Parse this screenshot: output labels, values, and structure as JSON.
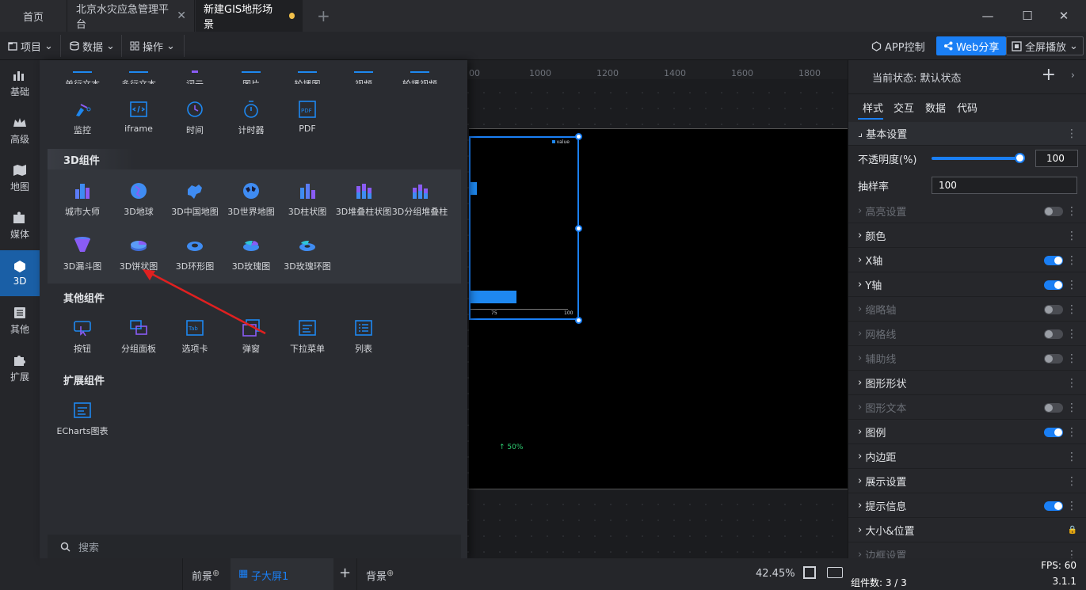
{
  "tabs": {
    "home": "首页",
    "beijing": "北京水灾应急管理平台",
    "gis": "新建GIS地形场景",
    "add": "+"
  },
  "window": {
    "minimize": "—",
    "maximize": "☐",
    "close": "✕"
  },
  "toolbar": {
    "project": "项目",
    "data": "数据",
    "operate": "操作",
    "app_control": "APP控制",
    "web_share": "Web分享",
    "fullscreen": "全屏播放"
  },
  "leftnav": [
    "基础",
    "高级",
    "地图",
    "媒体",
    "3D",
    "其他",
    "扩展"
  ],
  "basic_row1": [
    "单行文本",
    "多行文本",
    "词云",
    "图片",
    "轮播图",
    "视频",
    "轮播视频"
  ],
  "basic_row2": [
    "监控",
    "iframe",
    "时间",
    "计时器",
    "PDF"
  ],
  "section_3d": "3D组件",
  "comp3d_row1": [
    "城市大师",
    "3D地球",
    "3D中国地图",
    "3D世界地图",
    "3D柱状图",
    "3D堆叠柱状图",
    "3D分组堆叠柱"
  ],
  "comp3d_row2": [
    "3D漏斗图",
    "3D饼状图",
    "3D环形图",
    "3D玫瑰图",
    "3D玫瑰环图"
  ],
  "section_other": "其他组件",
  "other": [
    "按钮",
    "分组面板",
    "选项卡",
    "弹窗",
    "下拉菜单",
    "列表"
  ],
  "section_ext": "扩展组件",
  "ext": [
    "ECharts图表"
  ],
  "search_placeholder": "搜索",
  "ruler_labels": [
    "00",
    "1000",
    "1200",
    "1400",
    "1600",
    "1800"
  ],
  "canvas": {
    "legend": "value",
    "tick_a": "75",
    "tick_b": "100",
    "trend": "↑ 50%"
  },
  "right": {
    "state_label": "当前状态: 默认状态",
    "tabs": [
      "样式",
      "交互",
      "数据",
      "代码"
    ],
    "basic_settings": "基本设置",
    "opacity_label": "不透明度(%)",
    "opacity_value": "100",
    "opacity_level": 1.0,
    "sampling_label": "抽样率",
    "sampling_value": "100",
    "sections": [
      {
        "label": "高亮设置",
        "enabled": false,
        "toggle": "off"
      },
      {
        "label": "颜色",
        "enabled": true,
        "toggle": "none"
      },
      {
        "label": "X轴",
        "enabled": true,
        "toggle": "on"
      },
      {
        "label": "Y轴",
        "enabled": true,
        "toggle": "on"
      },
      {
        "label": "缩略轴",
        "enabled": false,
        "toggle": "off"
      },
      {
        "label": "网格线",
        "enabled": false,
        "toggle": "off"
      },
      {
        "label": "辅助线",
        "enabled": false,
        "toggle": "off"
      },
      {
        "label": "图形形状",
        "enabled": true,
        "toggle": "none"
      },
      {
        "label": "图形文本",
        "enabled": false,
        "toggle": "off"
      },
      {
        "label": "图例",
        "enabled": true,
        "toggle": "on"
      },
      {
        "label": "内边距",
        "enabled": true,
        "toggle": "none"
      },
      {
        "label": "展示设置",
        "enabled": true,
        "toggle": "none"
      },
      {
        "label": "提示信息",
        "enabled": true,
        "toggle": "on"
      },
      {
        "label": "大小&位置",
        "enabled": true,
        "toggle": "lock"
      },
      {
        "label": "边框设置",
        "enabled": false,
        "toggle": "none"
      }
    ],
    "fps": "FPS: 60",
    "component_count": "组件数: 3 / 3",
    "version": "3.1.1"
  },
  "bottom": {
    "foreground": "前景",
    "subscreen": "子大屏1",
    "background": "背景",
    "zoom": "42.45%"
  },
  "colors": {
    "accent": "#1a7ff5",
    "active_nav": "#1a5fa6",
    "arrow": "#e02020"
  }
}
